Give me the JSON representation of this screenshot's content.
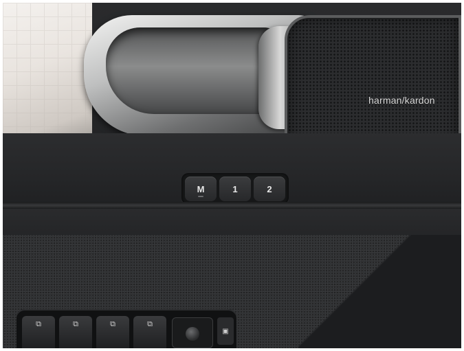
{
  "speaker": {
    "brand_label": "harman/kardon"
  },
  "memory_buttons": {
    "m_label": "M",
    "one_label": "1",
    "two_label": "2"
  },
  "window_switches": {
    "glyph": "⧉"
  },
  "colors": {
    "trim_dark": "#1b1c1e",
    "chrome": "#bfc0c0",
    "logo_text": "#d9d9d9"
  }
}
